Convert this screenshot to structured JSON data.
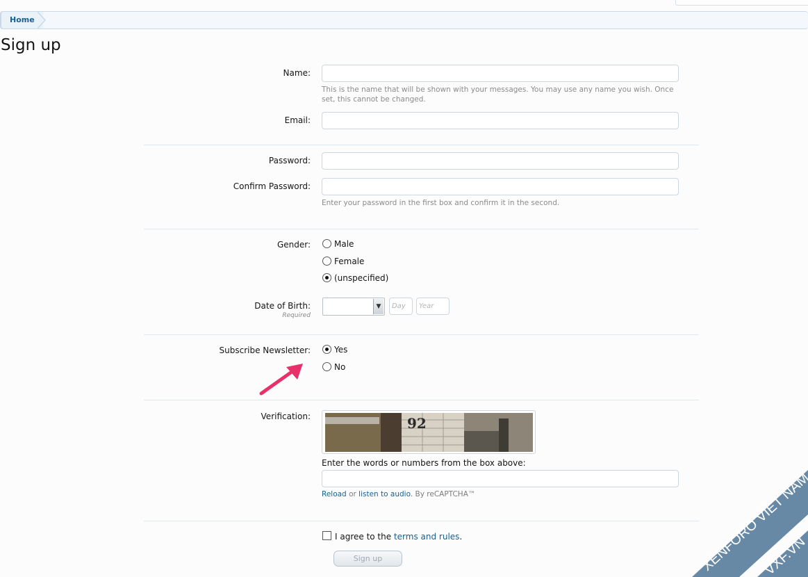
{
  "breadcrumb": {
    "home": "Home"
  },
  "page": {
    "title": "Sign up"
  },
  "form": {
    "name": {
      "label": "Name:",
      "value": "",
      "hint": "This is the name that will be shown with your messages. You may use any name you wish. Once set, this cannot be changed."
    },
    "email": {
      "label": "Email:",
      "value": ""
    },
    "password": {
      "label": "Password:",
      "value": ""
    },
    "confirm_password": {
      "label": "Confirm Password:",
      "value": "",
      "hint": "Enter your password in the first box and confirm it in the second."
    },
    "gender": {
      "label": "Gender:",
      "options": [
        {
          "label": "Male",
          "selected": false
        },
        {
          "label": "Female",
          "selected": false
        },
        {
          "label": "(unspecified)",
          "selected": true
        }
      ]
    },
    "dob": {
      "label": "Date of Birth:",
      "required": "Required",
      "month_value": "",
      "day_placeholder": "Day",
      "year_placeholder": "Year"
    },
    "newsletter": {
      "label": "Subscribe Newsletter:",
      "options": [
        {
          "label": "Yes",
          "selected": true
        },
        {
          "label": "No",
          "selected": false
        }
      ]
    },
    "verification": {
      "label": "Verification:",
      "prompt": "Enter the words or numbers from the box above:",
      "value": "",
      "reload": "Reload",
      "or": "or",
      "listen": "listen to audio",
      "by": ". By reCAPTCHA™",
      "captcha_text": "92"
    },
    "agree": {
      "prefix": "I agree to the",
      "link": "terms and rules",
      "suffix": ".",
      "checked": false
    },
    "submit": {
      "label": "Sign up"
    }
  },
  "watermark": {
    "line1": "XENFORO VIET NAM",
    "line2": "VXF.VN"
  },
  "colors": {
    "link": "#176093",
    "annotation_arrow": "#e8306a",
    "watermark_bg": "#5b7f9e"
  }
}
